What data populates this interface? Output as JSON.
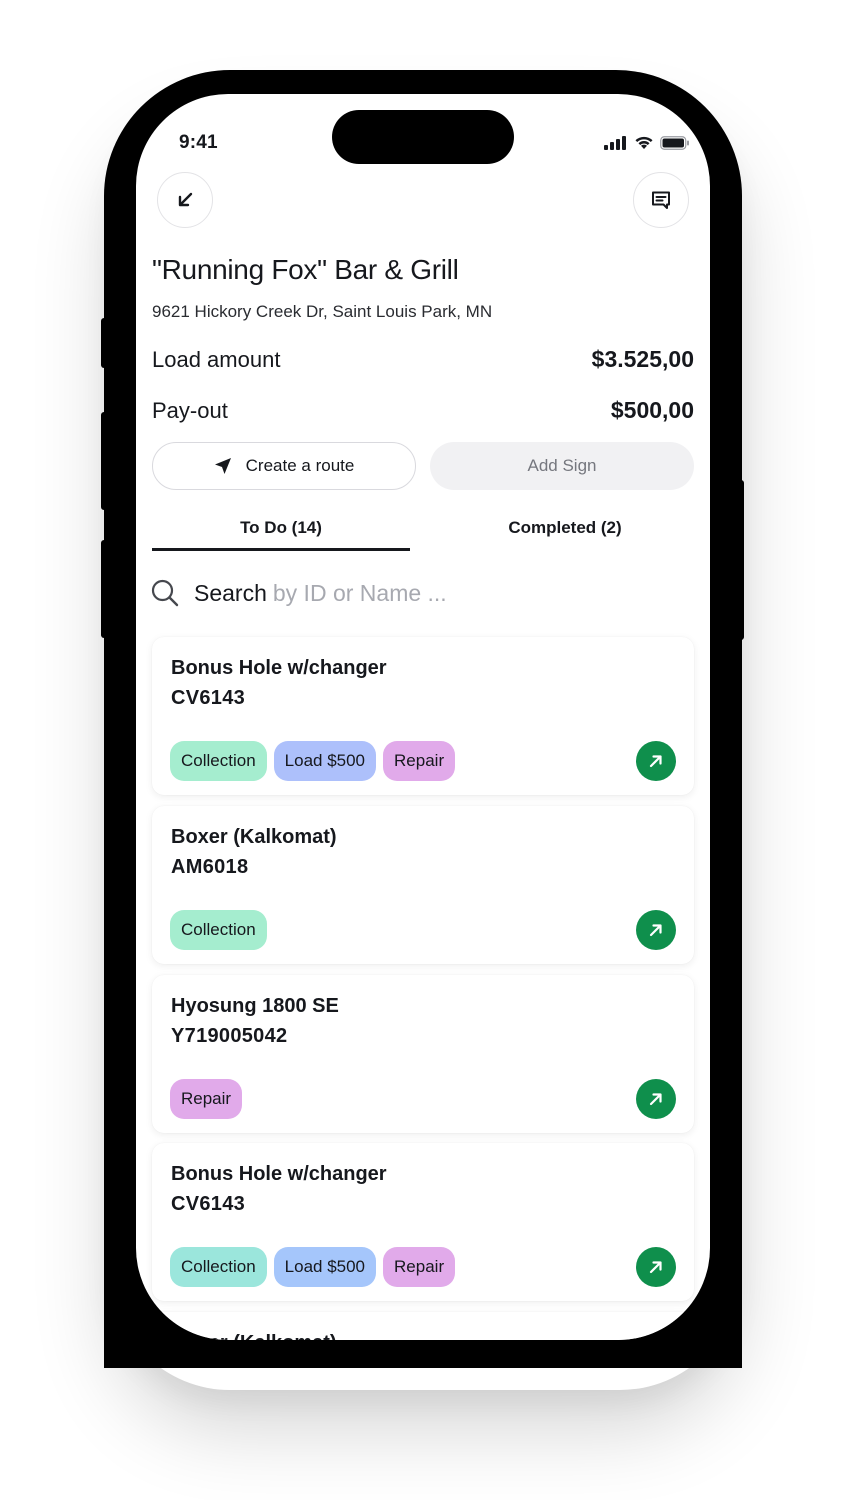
{
  "status_bar": {
    "time": "9:41"
  },
  "header": {
    "back_icon": "arrow-down-left-icon",
    "message_icon": "message-icon"
  },
  "venue": {
    "title": "\"Running Fox\" Bar & Grill",
    "address": "9621 Hickory Creek Dr, Saint Louis Park, MN"
  },
  "summary": [
    {
      "label": "Load amount",
      "value": "$3.525,00"
    },
    {
      "label": "Pay-out",
      "value": "$500,00"
    }
  ],
  "actions": {
    "create_route": {
      "label": "Create a route",
      "icon": "navigation-arrow-icon"
    },
    "add_sign": {
      "label": "Add Sign"
    }
  },
  "tabs": [
    {
      "label": "To Do (14)",
      "active": true
    },
    {
      "label": "Completed (2)",
      "active": false
    }
  ],
  "search": {
    "label": "Search",
    "placeholder": "by ID or Name ..."
  },
  "colors": {
    "collection": "#a5edcf",
    "collection_alt": "#9be6dc",
    "load": "#adc0fb",
    "load_alt": "#a5c6fb",
    "repair": "#e1aaea",
    "go_button": "#0f8f4c"
  },
  "machines": [
    {
      "name": "Bonus Hole w/changer",
      "id": "CV6143",
      "tags": [
        {
          "label": "Collection",
          "type": "collection"
        },
        {
          "label": "Load $500",
          "type": "load"
        },
        {
          "label": "Repair",
          "type": "repair"
        }
      ]
    },
    {
      "name": "Boxer (Kalkomat)",
      "id": "AM6018",
      "tags": [
        {
          "label": "Collection",
          "type": "collection"
        }
      ]
    },
    {
      "name": "Hyosung 1800 SE",
      "id": "Y719005042",
      "tags": [
        {
          "label": "Repair",
          "type": "repair"
        }
      ]
    },
    {
      "name": "Bonus Hole w/changer",
      "id": "CV6143",
      "tags": [
        {
          "label": "Collection",
          "type": "collection_alt"
        },
        {
          "label": "Load $500",
          "type": "load_alt"
        },
        {
          "label": "Repair",
          "type": "repair"
        }
      ]
    },
    {
      "name": "Boxer (Kalkomat)",
      "id": "",
      "tags": []
    }
  ]
}
